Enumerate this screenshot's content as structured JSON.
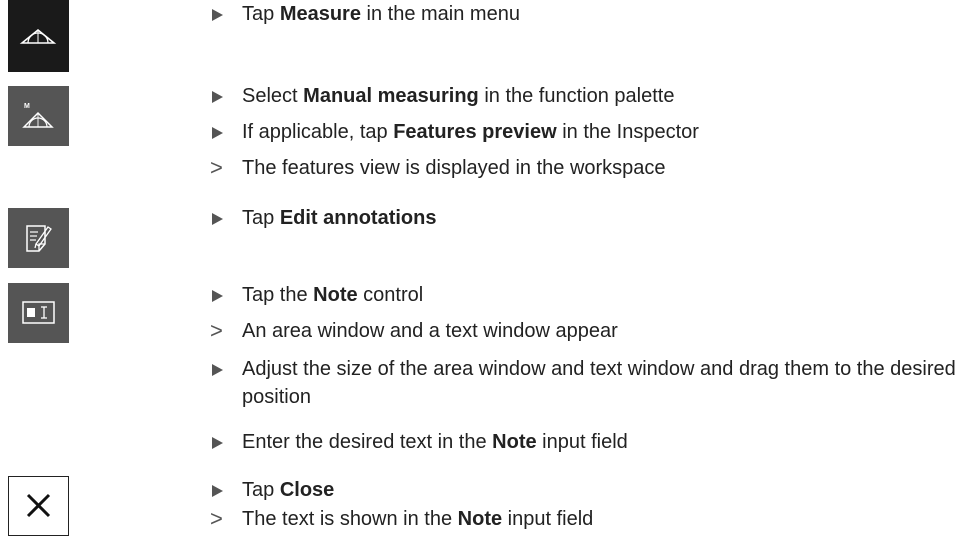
{
  "icons": [
    {
      "name": "measure-icon",
      "style": "dark-tile",
      "bg": "#1a1a1a"
    },
    {
      "name": "manual-measuring-icon",
      "style": "gray-tile",
      "bg": "#555555",
      "label": "M"
    },
    {
      "name": "edit-annotations-icon",
      "style": "gray-tile",
      "bg": "#555555"
    },
    {
      "name": "note-control-icon",
      "style": "gray-tile",
      "bg": "#555555"
    },
    {
      "name": "close-icon",
      "style": "outline-tile",
      "bg": "#ffffff"
    }
  ],
  "steps": [
    {
      "kind": "action",
      "parts": [
        {
          "t": "Tap "
        },
        {
          "t": "Measure",
          "b": true
        },
        {
          "t": " in the main menu"
        }
      ]
    },
    {
      "kind": "action",
      "parts": [
        {
          "t": "Select "
        },
        {
          "t": "Manual measuring",
          "b": true
        },
        {
          "t": " in the function palette"
        }
      ]
    },
    {
      "kind": "action",
      "parts": [
        {
          "t": "If applicable, tap "
        },
        {
          "t": "Features preview",
          "b": true
        },
        {
          "t": " in the Inspector"
        }
      ]
    },
    {
      "kind": "result",
      "marker": ">",
      "parts": [
        {
          "t": "The features view is displayed in the workspace"
        }
      ]
    },
    {
      "kind": "action",
      "parts": [
        {
          "t": "Tap "
        },
        {
          "t": "Edit annotations",
          "b": true
        }
      ]
    },
    {
      "kind": "action",
      "parts": [
        {
          "t": "Tap the "
        },
        {
          "t": "Note",
          "b": true
        },
        {
          "t": " control"
        }
      ]
    },
    {
      "kind": "result",
      "marker": ">",
      "parts": [
        {
          "t": "An area window and a text window appear"
        }
      ]
    },
    {
      "kind": "action",
      "parts": [
        {
          "t": "Adjust the size of the area window and text window and drag them to the desired position"
        }
      ]
    },
    {
      "kind": "action",
      "parts": [
        {
          "t": "Enter the desired text in the "
        },
        {
          "t": "Note",
          "b": true
        },
        {
          "t": " input field"
        }
      ]
    },
    {
      "kind": "action",
      "parts": [
        {
          "t": "Tap "
        },
        {
          "t": "Close",
          "b": true
        }
      ]
    },
    {
      "kind": "result",
      "marker": ">",
      "parts": [
        {
          "t": "The text is shown in the "
        },
        {
          "t": "Note",
          "b": true
        },
        {
          "t": " input field"
        }
      ]
    }
  ]
}
